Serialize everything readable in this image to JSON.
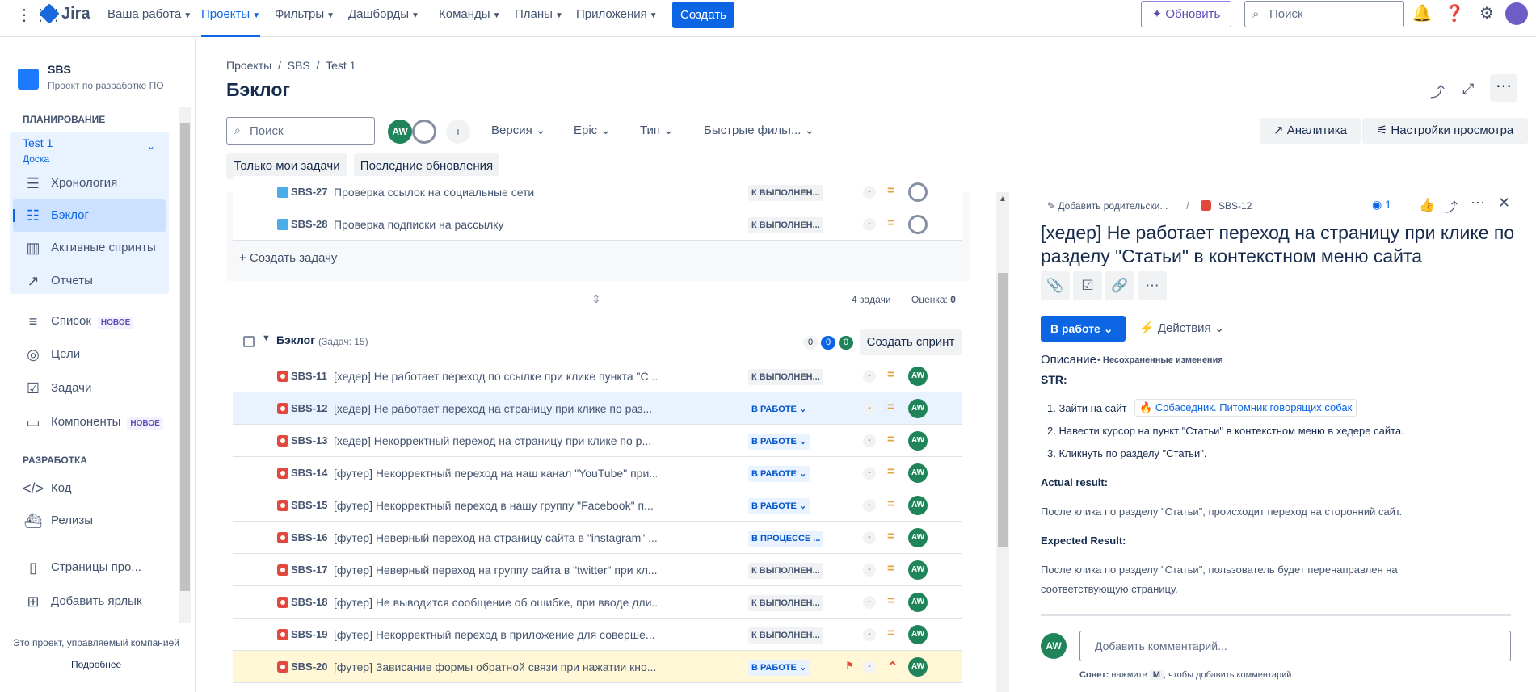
{
  "topnav": {
    "logo_text": "Jira",
    "menu": [
      "Ваша работа",
      "Проекты",
      "Фильтры",
      "Дашборды",
      "Команды",
      "Планы",
      "Приложения"
    ],
    "create_label": "Создать",
    "update_label": "Обновить",
    "search_placeholder": "Поиск"
  },
  "sidebar": {
    "project_name": "SBS",
    "project_desc": "Проект по разработке ПО",
    "planning_title": "ПЛАНИРОВАНИЕ",
    "board_name": "Test 1",
    "board_type": "Доска",
    "planning_items": [
      "Хронология",
      "Бэклог",
      "Активные спринты",
      "Отчеты"
    ],
    "other_items": [
      "Список",
      "Цели",
      "Задачи",
      "Компоненты"
    ],
    "new_badge": "НОВОЕ",
    "dev_title": "РАЗРАБОТКА",
    "dev_items": [
      "Код",
      "Релизы"
    ],
    "extra_items": [
      "Страницы про...",
      "Добавить ярлык"
    ],
    "footer_text": "Это проект, управляемый компанией",
    "footer_link": "Подробнее"
  },
  "main": {
    "breadcrumb": [
      "Проекты",
      "SBS",
      "Test 1"
    ],
    "title": "Бэклог",
    "search_placeholder": "Поиск",
    "avatar_initials": "AW",
    "filters": [
      "Версия",
      "Epic",
      "Тип",
      "Быстрые фильт..."
    ],
    "analytics_label": "Аналитика",
    "view_settings_label": "Настройки просмотра",
    "quick_filters": [
      "Только мои задачи",
      "Последние обновления"
    ],
    "create_task_label": "+ Создать задачу",
    "sprint_count": "4 задачи",
    "sprint_estimate_label": "Оценка:",
    "sprint_estimate_value": "0",
    "backlog_title": "Бэклог",
    "backlog_count": "(Задач: 15)",
    "backlog_counts": [
      "0",
      "0",
      "0"
    ],
    "create_sprint_label": "Создать спринт"
  },
  "sprint_rows": [
    {
      "key": "SBS-27",
      "summary": "Проверка ссылок на социальные сети",
      "status": "К ВЫПОЛНЕН..."
    },
    {
      "key": "SBS-28",
      "summary": "Проверка подписки на рассылку",
      "status": "К ВЫПОЛНЕН..."
    }
  ],
  "backlog_rows": [
    {
      "key": "SBS-11",
      "summary": "[хедер] Не работает переход по ссылке при клике пункта \"С...",
      "status": "К ВЫПОЛНЕН...",
      "est": "-",
      "assignee": "AW"
    },
    {
      "key": "SBS-12",
      "summary": "[хедер] Не работает переход на страницу при клике по раз...",
      "status": "В РАБОТЕ ⌄",
      "est": "-",
      "assignee": "AW"
    },
    {
      "key": "SBS-13",
      "summary": "[хедер] Некорректный переход на страницу при клике по р...",
      "status": "В РАБОТЕ ⌄",
      "est": "-",
      "assignee": "AW"
    },
    {
      "key": "SBS-14",
      "summary": "[футер] Некорректный переход на наш канал \"YouTube\" при...",
      "status": "В РАБОТЕ ⌄",
      "est": "-",
      "assignee": "AW"
    },
    {
      "key": "SBS-15",
      "summary": "[футер] Некорректный переход в нашу группу \"Facebook\" п...",
      "status": "В РАБОТЕ ⌄",
      "est": "-",
      "assignee": "AW"
    },
    {
      "key": "SBS-16",
      "summary": "[футер] Неверный переход на страницу сайта в \"instagram\" ...",
      "status": "В ПРОЦЕССЕ ...",
      "est": "-",
      "assignee": "AW"
    },
    {
      "key": "SBS-17",
      "summary": "[футер] Неверный переход на группу сайта в \"twitter\" при кл...",
      "status": "К ВЫПОЛНЕН...",
      "est": "-",
      "assignee": "AW"
    },
    {
      "key": "SBS-18",
      "summary": "[футер] Не выводится сообщение об ошибке, при вводе дли...",
      "status": "К ВЫПОЛНЕН...",
      "est": "-",
      "assignee": "AW"
    },
    {
      "key": "SBS-19",
      "summary": "[футер] Некорректный переход в приложение для соверше...",
      "status": "К ВЫПОЛНЕН...",
      "est": "-",
      "assignee": "AW"
    },
    {
      "key": "SBS-20",
      "summary": "[футер] Зависание формы обратной связи при нажатии кно...",
      "status": "В РАБОТЕ ⌄",
      "est": "-",
      "assignee": "AW"
    }
  ],
  "detail": {
    "add_parent": "Добавить родительски...",
    "issue_key": "SBS-12",
    "watchers": "1",
    "title": "[хедер] Не работает переход на страницу при клике по разделу \"Статьи\" в контекстном меню сайта",
    "status_btn": "В работе",
    "actions_btn": "Действия",
    "desc_label": "Описание",
    "unsaved": "• Несохраненные изменения",
    "str_label": "STR:",
    "steps": [
      "Зайти на сайт",
      "Навести курсор на пункт \"Статьи\" в контекстном меню в хедере сайта.",
      "Кликнуть по разделу \"Статьи\"."
    ],
    "site_link": "Собаседник. Питомник говорящих собак",
    "actual_label": "Actual result:",
    "actual_text": "После клика по разделу \"Статьи\", происходит переход на сторонний сайт.",
    "expected_label": "Expected Result:",
    "expected_text_1": "После клика по разделу \"Статьи\", пользователь будет перенаправлен на",
    "expected_text_2": "соответствующую страницу.",
    "comment_placeholder": "Добавить комментарий...",
    "tip_prefix": "Совет:",
    "tip_mid": "нажмите",
    "tip_key": "M",
    "tip_suffix": ", чтобы добавить комментарий",
    "avatar": "AW"
  }
}
